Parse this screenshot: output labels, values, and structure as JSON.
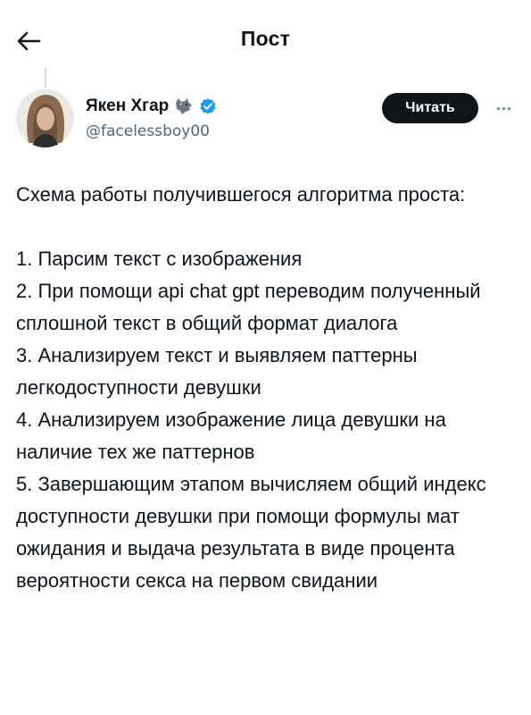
{
  "header": {
    "title": "Пост",
    "back_icon": "arrow-left-icon"
  },
  "author": {
    "name": "Якен Хгар",
    "emoji_icon": "wolf-icon",
    "verified_icon": "verified-badge-icon",
    "verified_color": "#1d9bf0",
    "handle": "@facelessboy00",
    "follow_label": "Читать",
    "more_icon": "more-dots-icon"
  },
  "post": {
    "intro": "Схема работы получившегося алгоритма проста:",
    "steps": [
      "1. Парсим текст с изображения",
      "2. При помощи api chat gpt переводим полученный сплошной текст в общий формат диалога",
      "3. Анализируем текст и выявляем паттерны легкодоступности девушки",
      "4. Анализируем изображение лица девушки на наличие тех же паттернов",
      "5. Завершающим этапом вычисляем общий индекс доступности девушки при помощи формулы мат ожидания и выдача результата в виде процента вероятности секса на первом свидании"
    ]
  },
  "colors": {
    "text": "#0f1419",
    "secondary": "#536471",
    "button_bg": "#0f1419"
  }
}
